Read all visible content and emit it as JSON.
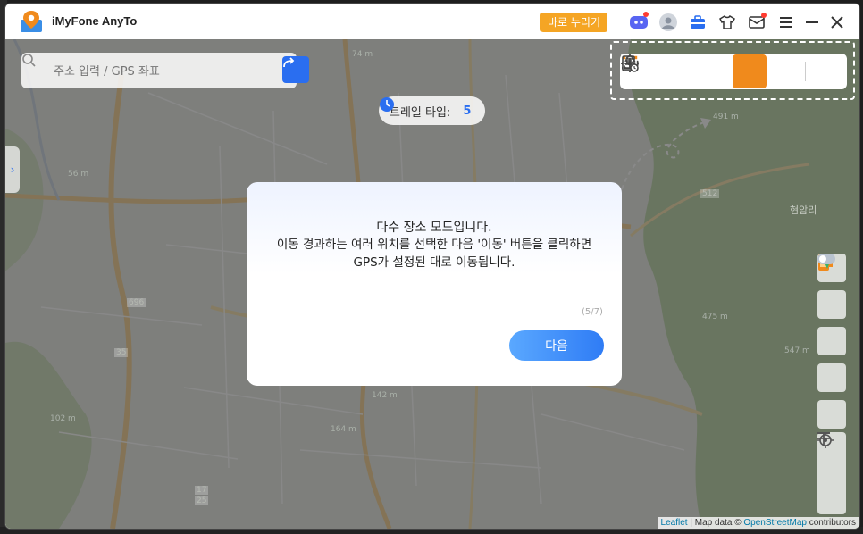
{
  "app": {
    "title": "iMyFone AnyTo",
    "free_button": "바로 누리기"
  },
  "titlebar_icons": [
    "discord-icon",
    "avatar-icon",
    "toolbox-icon",
    "shirt-icon",
    "mail-icon",
    "menu-icon",
    "minimize-icon",
    "close-icon"
  ],
  "search": {
    "placeholder": "주소 입력 / GPS 좌표"
  },
  "trail": {
    "label": "트레일 타입:",
    "value": "5"
  },
  "toolbar": {
    "tools": [
      "teleport-mode-icon",
      "jump-teleport-icon",
      "two-spot-mode-icon",
      "multi-spot-mode-icon",
      "joystick-mode-icon",
      "history-icon"
    ],
    "active": "multi-spot-mode-icon"
  },
  "dialog": {
    "title": "다수 장소 모드입니다.",
    "body": "이동 경과하는 여러 위치를 선택한 다음 '이동' 버튼을 클릭하면 GPS가 설정된 대로 이동됩니다.",
    "step": "(5/7)",
    "next_label": "다음"
  },
  "map_labels": [
    {
      "text": "현암리"
    },
    {
      "text": "491 m"
    },
    {
      "text": "512"
    },
    {
      "text": "696"
    },
    {
      "text": "35"
    },
    {
      "text": "17"
    },
    {
      "text": "25"
    },
    {
      "text": "142 m"
    },
    {
      "text": "56 m"
    },
    {
      "text": "475 m"
    },
    {
      "text": "547 m"
    },
    {
      "text": "164 m"
    },
    {
      "text": "102 m"
    },
    {
      "text": "74 m"
    }
  ],
  "attribution": {
    "leaflet": "Leaflet",
    "sep": " | Map data © ",
    "osm": "OpenStreetMap",
    "tail": " contributors"
  },
  "colors": {
    "accent_orange": "#f08a1c",
    "accent_blue": "#2a6ef0",
    "free_button": "#f5a524"
  }
}
